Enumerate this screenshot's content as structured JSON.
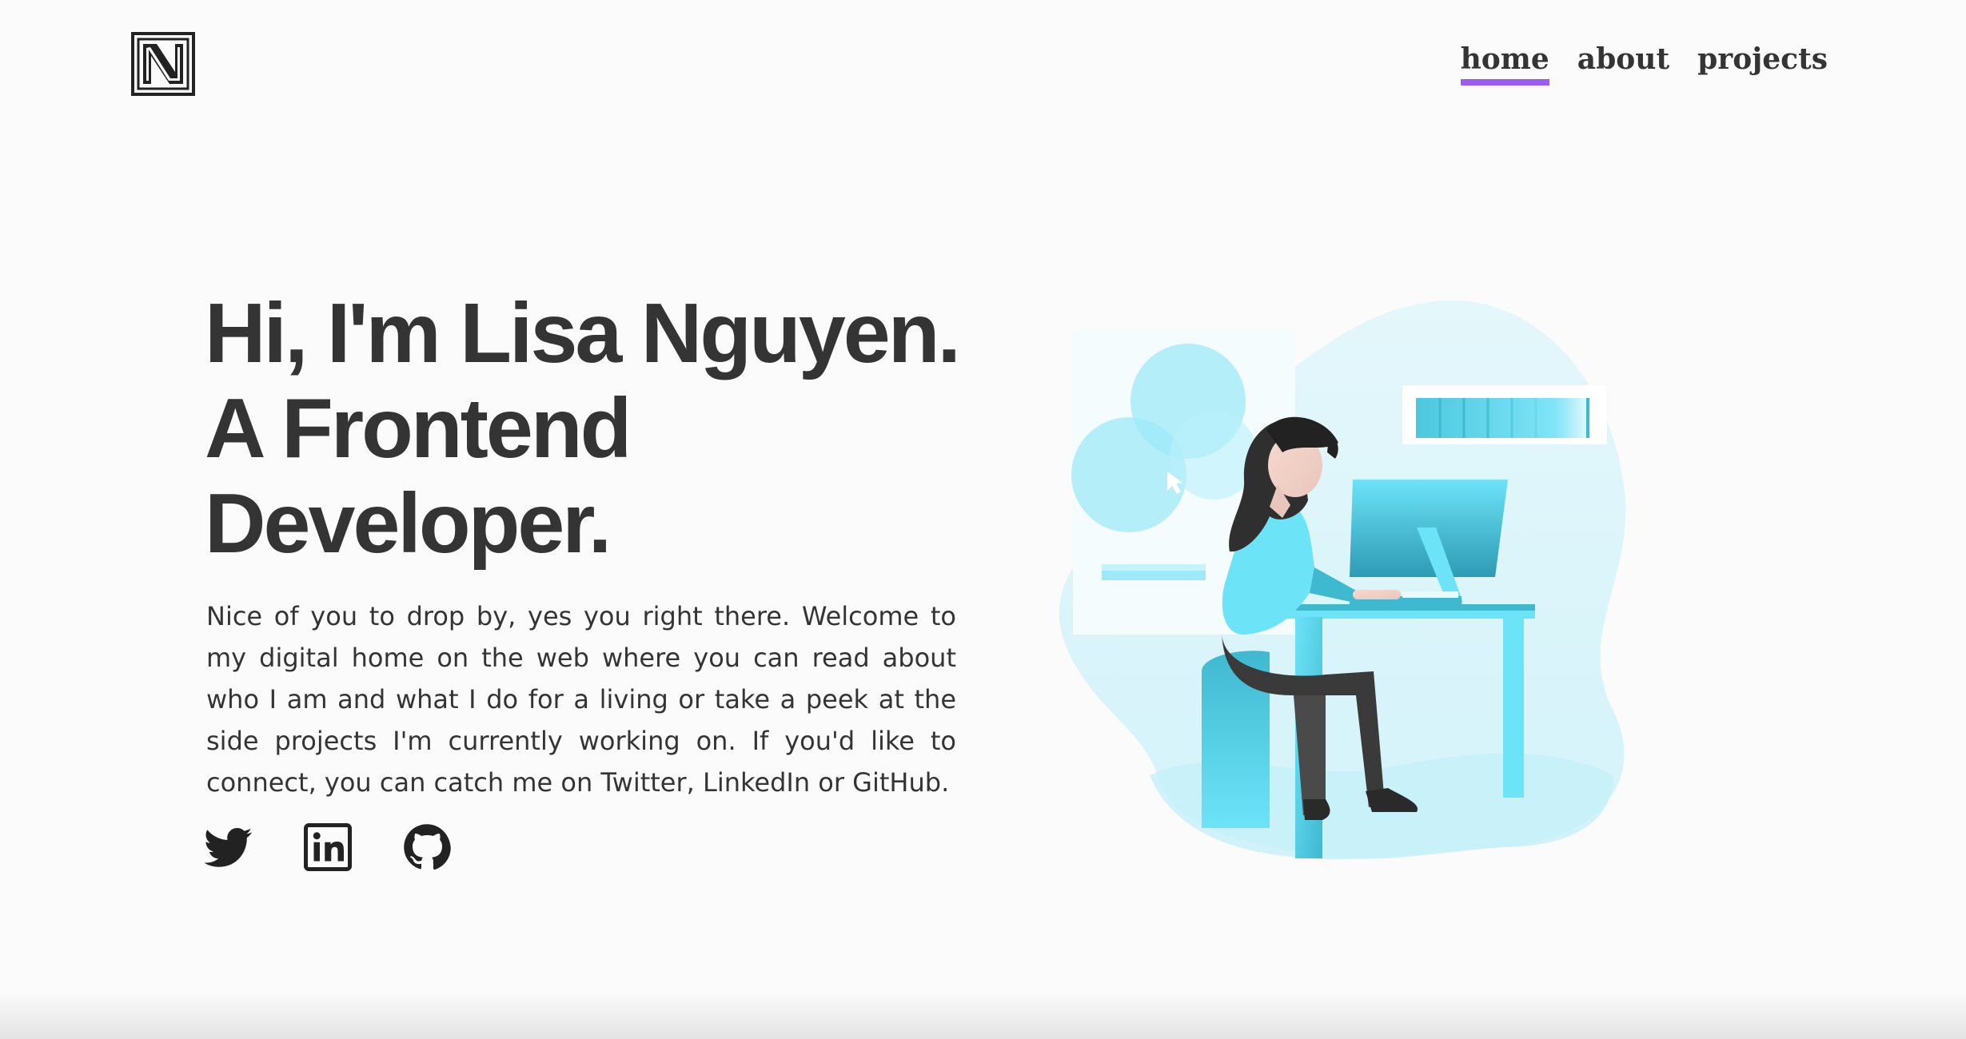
{
  "header": {
    "logo_icon": "monogram-logo-icon",
    "nav": [
      {
        "label": "home",
        "active": true
      },
      {
        "label": "about",
        "active": false
      },
      {
        "label": "projects",
        "active": false
      }
    ]
  },
  "hero": {
    "title_lines": [
      "Hi, I'm Lisa Nguyen.",
      "A Frontend",
      "Developer."
    ],
    "intro": "Nice of you to drop by, yes you right there. Welcome to my digital home on the web where you can read about who I am and what I do for a living or take a peek at the side projects I'm currently working on. If you'd like to connect, you can catch me on Twitter, LinkedIn or GitHub."
  },
  "social": [
    {
      "icon": "twitter-icon"
    },
    {
      "icon": "linkedin-icon"
    },
    {
      "icon": "github-icon"
    }
  ],
  "illustration": {
    "icon": "developer-at-desk-illustration"
  },
  "colors": {
    "accent": "#9a5cf2",
    "text": "#343434",
    "background": "#fcfbfc",
    "illustration_primary": "#6de3f8",
    "illustration_blob": "#dff6fb"
  }
}
